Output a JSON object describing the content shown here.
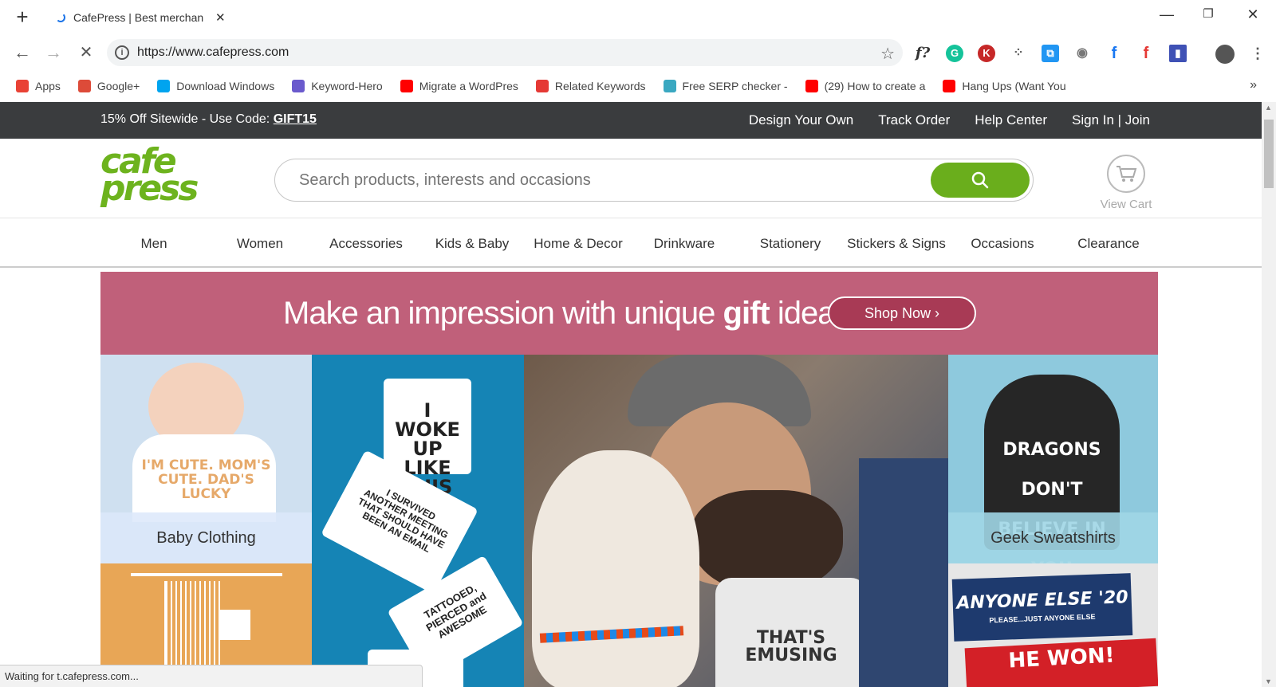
{
  "browser": {
    "tab_title": "CafePress | Best merchan",
    "url": "https://www.cafepress.com",
    "bookmarks": [
      {
        "label": "Apps",
        "color": "#e94235"
      },
      {
        "label": "Google+",
        "color": "#dd4b39"
      },
      {
        "label": "Download Windows",
        "color": "#00a4ef"
      },
      {
        "label": "Keyword-Hero",
        "color": "#6a5acd"
      },
      {
        "label": "Migrate a WordPres",
        "color": "#ff0000"
      },
      {
        "label": "Related Keywords",
        "color": "#e53935"
      },
      {
        "label": "Free SERP checker -",
        "color": "#3aa8c1"
      },
      {
        "label": "(29) How to create a",
        "color": "#ff0000"
      },
      {
        "label": "Hang Ups (Want You",
        "color": "#ff0000"
      }
    ],
    "status_text": "Waiting for t.cafepress.com..."
  },
  "promo": {
    "text": "15% Off Sitewide - Use Code: ",
    "code": "GIFT15",
    "links": [
      "Design Your Own",
      "Track Order",
      "Help Center",
      "Sign In | Join"
    ]
  },
  "header": {
    "logo_top": "cafe",
    "logo_bottom": "press",
    "search_placeholder": "Search products, interests and occasions",
    "cart_label": "View Cart"
  },
  "categories": [
    "Men",
    "Women",
    "Accessories",
    "Kids & Baby",
    "Home & Decor",
    "Drinkware",
    "Stationery",
    "Stickers & Signs",
    "Occasions",
    "Clearance"
  ],
  "banner": {
    "text_before": "Make an impression with unique ",
    "text_bold": "gift",
    "text_after": " ideas.",
    "button": "Shop Now ›"
  },
  "tiles": {
    "baby_label": "Baby Clothing",
    "baby_shirt_text": "I'M CUTE. MOM'S CUTE. DAD'S LUCKY",
    "geek_label": "Geek Sweatshirts",
    "geek_shirt_text": "DRAGONS DON'T BELIEVE IN YOU EITHER.",
    "mug_texts": [
      "I WOKE UP LIKE THIS",
      "I SURVIVED ANOTHER MEETING THAT SHOULD HAVE BEEN AN EMAIL",
      "TATTOOED, PIERCED and AWESOME"
    ],
    "dog_shirt_text": "THAT'S EMUSING",
    "sticker_top": "ANYONE ELSE '20",
    "sticker_sub": "PLEASE...JUST ANYONE ELSE",
    "sticker_bottom": "HE WON!"
  }
}
